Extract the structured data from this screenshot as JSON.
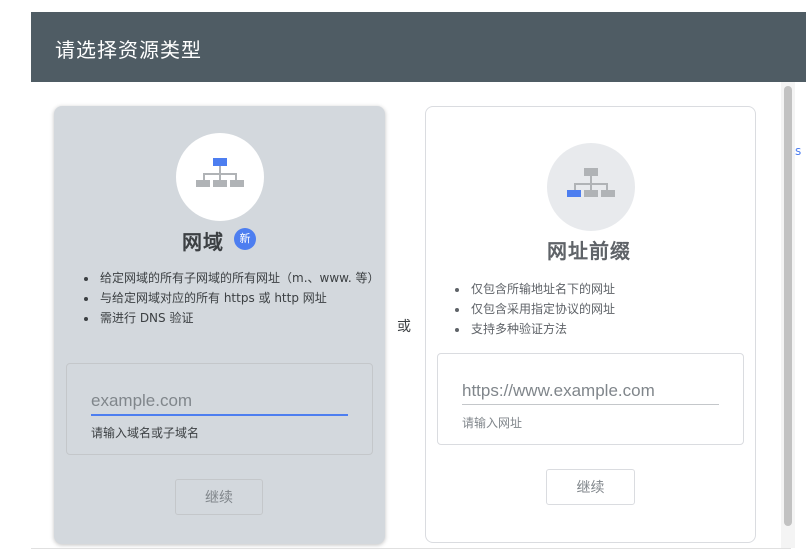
{
  "dialog": {
    "title": "请选择资源类型"
  },
  "domain_card": {
    "title": "网域",
    "badge": "新",
    "features": [
      "给定网域的所有子网域的所有网址（m.、www. 等）",
      "与给定网域对应的所有 https 或 http 网址",
      "需进行 DNS 验证"
    ],
    "input": {
      "placeholder": "example.com",
      "value": "",
      "hint": "请输入域名或子域名"
    },
    "button_label": "继续",
    "icon": "sitemap-icon"
  },
  "separator": {
    "label": "或"
  },
  "prefix_card": {
    "title": "网址前缀",
    "features": [
      "仅包含所输地址名下的网址",
      "仅包含采用指定协议的网址",
      "支持多种验证方法"
    ],
    "input": {
      "placeholder": "https://www.example.com",
      "value": "",
      "hint": "请输入网址"
    },
    "button_label": "继续",
    "icon": "sitemap-icon"
  },
  "edge_fragment": {
    "text": "s"
  },
  "colors": {
    "header": "#4f5c64",
    "accent": "#4d7ef0",
    "selected_card": "#d3d8dd",
    "icon_gray": "#b0b3b6"
  }
}
